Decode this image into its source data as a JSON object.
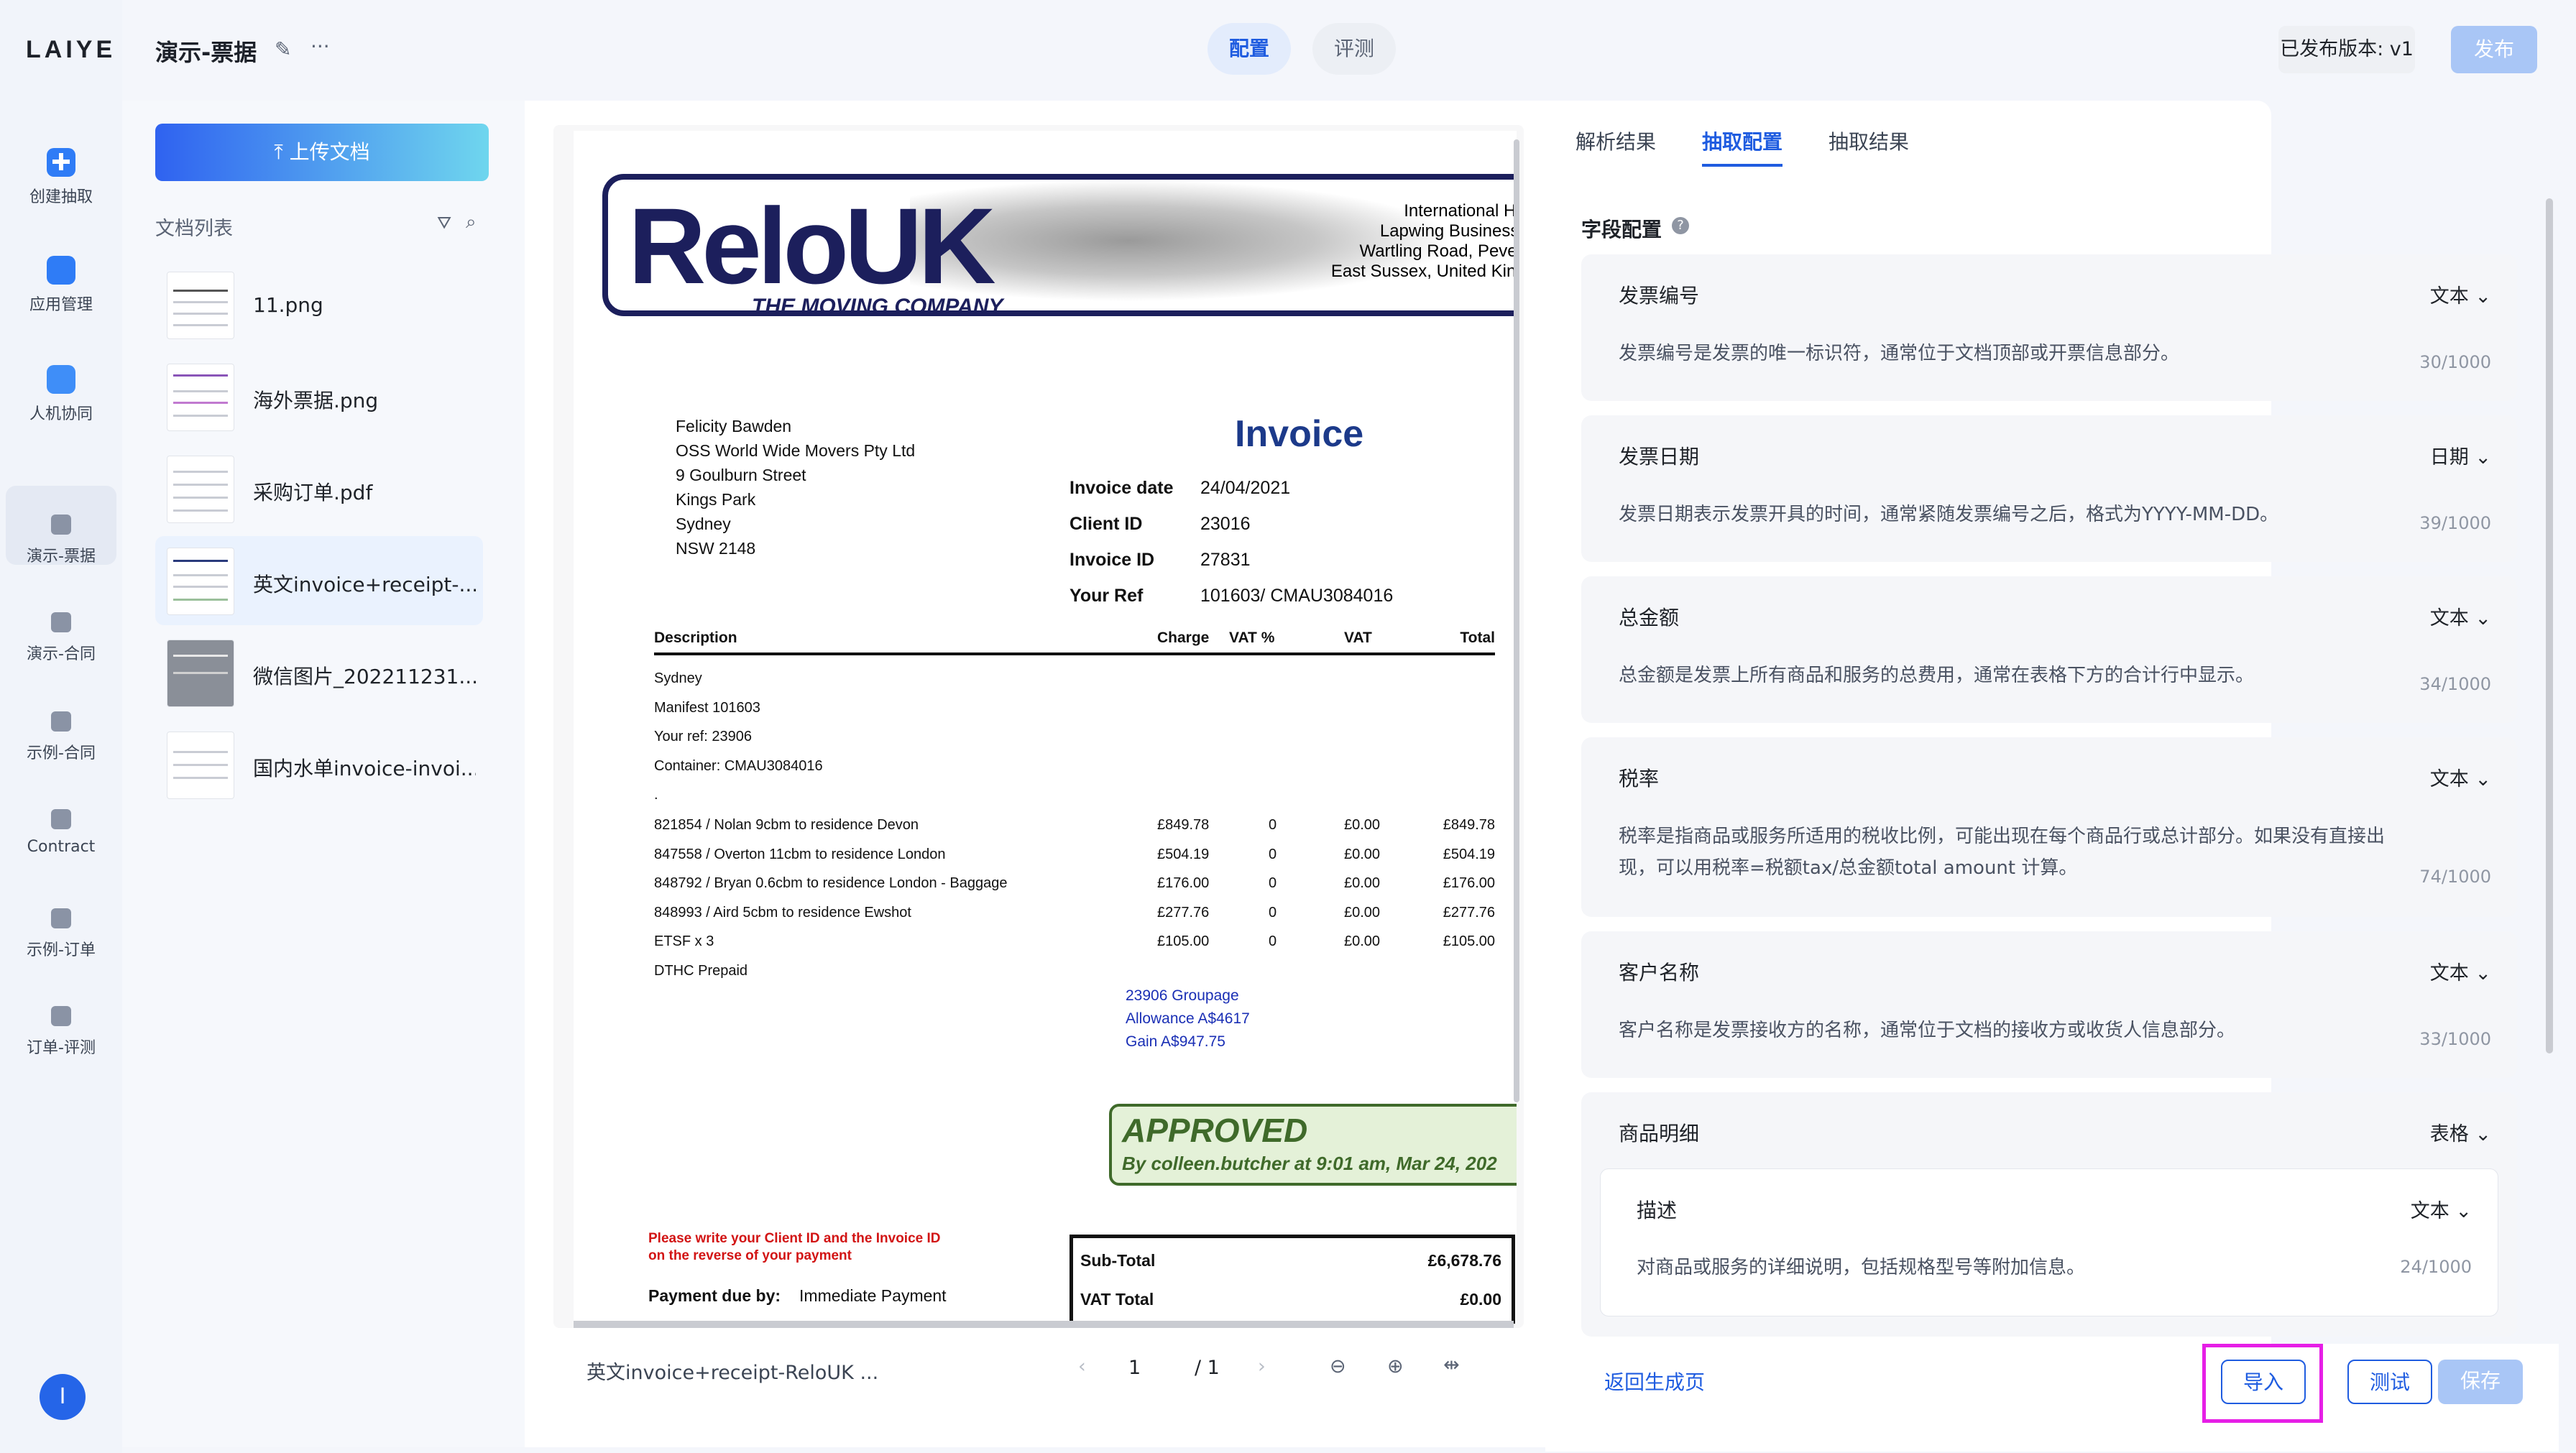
{
  "brand": {
    "logo": "LAIYE"
  },
  "nav": {
    "items": [
      {
        "label": "创建抽取",
        "icon": "plus-icon"
      },
      {
        "label": "应用管理",
        "icon": "folder-icon"
      },
      {
        "label": "人机协同",
        "icon": "monitor-icon"
      },
      {
        "label": "演示-票据",
        "icon": "edit-doc-icon"
      },
      {
        "label": "演示-合同",
        "icon": "edit-doc-icon"
      },
      {
        "label": "示例-合同",
        "icon": "edit-doc-icon"
      },
      {
        "label": "Contract",
        "icon": "edit-doc-icon"
      },
      {
        "label": "示例-订单",
        "icon": "edit-doc-icon"
      },
      {
        "label": "订单-评测",
        "icon": "edit-doc-icon"
      }
    ],
    "avatar": "I"
  },
  "header": {
    "title": "演示-票据",
    "more": "···",
    "tabs": [
      "配置",
      "评测"
    ],
    "version": "已发布版本: v1",
    "publish": "发布"
  },
  "sidebar": {
    "upload": "上传文档",
    "list_label": "文档列表",
    "docs": [
      "11.png",
      "海外票据.png",
      "采购订单.pdf",
      "英文invoice+receipt-...",
      "微信图片_202211231...",
      "国内水单invoice-invoi..."
    ]
  },
  "invoice": {
    "company_lines": [
      "International Hou",
      "Lapwing Business P",
      "Wartling Road, Pevens",
      "East Sussex, United Kingd"
    ],
    "tagline": "THE MOVING COMPANY",
    "logo": "ReloUK",
    "address": [
      "Felicity Bawden",
      "OSS World Wide Movers Pty Ltd",
      "9 Goulburn Street",
      "Kings Park",
      "Sydney",
      "NSW 2148"
    ],
    "heading": "Invoice",
    "meta": [
      {
        "k": "Invoice date",
        "v": "24/04/2021"
      },
      {
        "k": "Client ID",
        "v": "23016"
      },
      {
        "k": "Invoice ID",
        "v": "27831"
      },
      {
        "k": "Your Ref",
        "v": "101603/ CMAU3084016"
      }
    ],
    "cols": [
      "Description",
      "Charge",
      "VAT %",
      "VAT",
      "Total"
    ],
    "pre_lines": [
      "Sydney",
      "Manifest 101603",
      "Your ref: 23906",
      "Container: CMAU3084016",
      "."
    ],
    "rows": [
      [
        "821854 / Nolan 9cbm to residence Devon",
        "£849.78",
        "0",
        "£0.00",
        "£849.78"
      ],
      [
        "847558 / Overton 11cbm to residence London",
        "£504.19",
        "0",
        "£0.00",
        "£504.19"
      ],
      [
        "848792 / Bryan 0.6cbm to residence London - Baggage",
        "£176.00",
        "0",
        "£0.00",
        "£176.00"
      ],
      [
        "848993 / Aird 5cbm to residence Ewshot",
        "£277.76",
        "0",
        "£0.00",
        "£277.76"
      ],
      [
        "ETSF x 3",
        "£105.00",
        "0",
        "£0.00",
        "£105.00"
      ]
    ],
    "post_line": "DTHC Prepaid",
    "handwritten": [
      "23906 Groupage",
      "Allowance A$4617",
      "Gain A$947.75"
    ],
    "stamp": {
      "title": "APPROVED",
      "by": "By colleen.butcher at 9:01 am, Mar 24, 202"
    },
    "note": [
      "Please write your Client ID and the Invoice ID",
      "on the reverse of your payment"
    ],
    "payment_due_label": "Payment due by:",
    "payment_due_value": "Immediate Payment",
    "totals": [
      {
        "k": "Sub-Total",
        "v": "£6,678.76"
      },
      {
        "k": "VAT Total",
        "v": "£0.00"
      }
    ]
  },
  "viewer": {
    "filename": "英文invoice+receipt-ReloUK ...",
    "page": "1",
    "total": "/ 1"
  },
  "right": {
    "tabs": [
      "解析结果",
      "抽取配置",
      "抽取结果"
    ],
    "section": "字段配置",
    "fields": [
      {
        "name": "发票编号",
        "type": "文本",
        "desc": "发票编号是发票的唯一标识符，通常位于文档顶部或开票信息部分。",
        "count": "30/1000"
      },
      {
        "name": "发票日期",
        "type": "日期",
        "desc": "发票日期表示发票开具的时间，通常紧随发票编号之后，格式为YYYY-MM-DD。",
        "count": "39/1000"
      },
      {
        "name": "总金额",
        "type": "文本",
        "desc": "总金额是发票上所有商品和服务的总费用，通常在表格下方的合计行中显示。",
        "count": "34/1000"
      },
      {
        "name": "税率",
        "type": "文本",
        "desc": "税率是指商品或服务所适用的税收比例，可能出现在每个商品行或总计部分。如果没有直接出现，可以用税率=税额tax/总金额total amount 计算。",
        "count": "74/1000"
      },
      {
        "name": "客户名称",
        "type": "文本",
        "desc": "客户名称是发票接收方的名称，通常位于文档的接收方或收货人信息部分。",
        "count": "33/1000"
      }
    ],
    "table_field": {
      "name": "商品明细",
      "type": "表格",
      "sub": {
        "name": "描述",
        "type": "文本",
        "desc": "对商品或服务的详细说明，包括规格型号等附加信息。",
        "count": "24/1000"
      }
    },
    "footer": {
      "back": "返回生成页",
      "import": "导入",
      "test": "测试",
      "save": "保存"
    }
  },
  "colors": {
    "primary": "#1f5ce0",
    "highlight": "#e61ee6"
  }
}
